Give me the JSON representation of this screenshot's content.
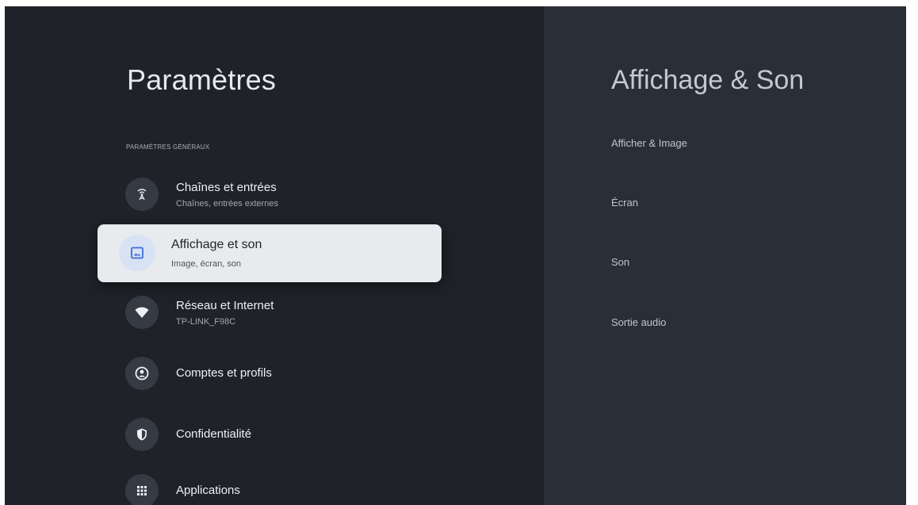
{
  "settings": {
    "title": "Paramètres",
    "section_label": "PARAMÈTRES GÉNÉRAUX",
    "items": [
      {
        "title": "Chaînes et entrées",
        "subtitle": "Chaînes, entrées externes",
        "icon": "antenna-icon"
      },
      {
        "title": "Affichage et son",
        "subtitle": "Image, écran, son",
        "icon": "display-image-icon",
        "selected": true
      },
      {
        "title": "Réseau et Internet",
        "subtitle": "TP-LINK_F98C",
        "icon": "wifi-icon"
      },
      {
        "title": "Comptes et profils",
        "icon": "account-icon"
      },
      {
        "title": "Confidentialité",
        "icon": "shield-icon"
      },
      {
        "title": "Applications",
        "icon": "apps-grid-icon"
      }
    ]
  },
  "detail": {
    "title": "Affichage & Son",
    "items": [
      "Afficher & Image",
      "Écran",
      "Son",
      "Sortie audio"
    ]
  },
  "colors": {
    "background": "#1f2228",
    "detail_pane": "#2a2e36",
    "selected_card": "#e8eaed",
    "selected_icon_bg": "#d7e2f5",
    "accent_blue": "#3d6fd6"
  }
}
